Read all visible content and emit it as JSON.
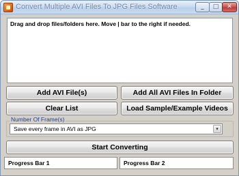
{
  "window": {
    "title": "Convert Multiple AVI Files To JPG Files Software",
    "minimize_glyph": "_",
    "maximize_glyph": "□",
    "close_glyph": "✕"
  },
  "drop_area": {
    "hint": "Drag and drop files/folders here. Move | bar to the right if needed."
  },
  "buttons": {
    "add_files": "Add AVI File(s)",
    "add_folder": "Add All AVI Files In Folder",
    "clear_list": "Clear List",
    "load_sample": "Load Sample/Example Videos",
    "start": "Start Converting"
  },
  "frames_group": {
    "label": "Number Of Frame(s)",
    "selected": "Save every frame in AVI as JPG",
    "arrow_glyph": "▾"
  },
  "progress": {
    "bar1_label": "Progress Bar 1",
    "bar2_label": "Progress Bar 2"
  },
  "icons": {
    "app": "app-icon",
    "dropdown": "chevron-down-icon"
  }
}
